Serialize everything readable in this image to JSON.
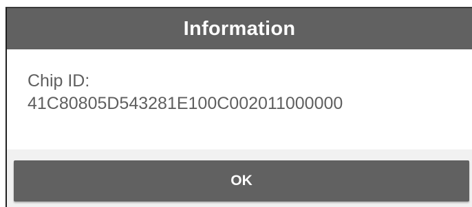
{
  "dialog": {
    "title": "Information",
    "message": {
      "label": "Chip ID:",
      "value": "41C80805D543281E100C002011000000"
    },
    "ok_label": "OK"
  },
  "colors": {
    "title_bar": "#616161",
    "button": "#616161",
    "message_text": "#5f5f5f",
    "footer_background": "#f1f1f1"
  }
}
